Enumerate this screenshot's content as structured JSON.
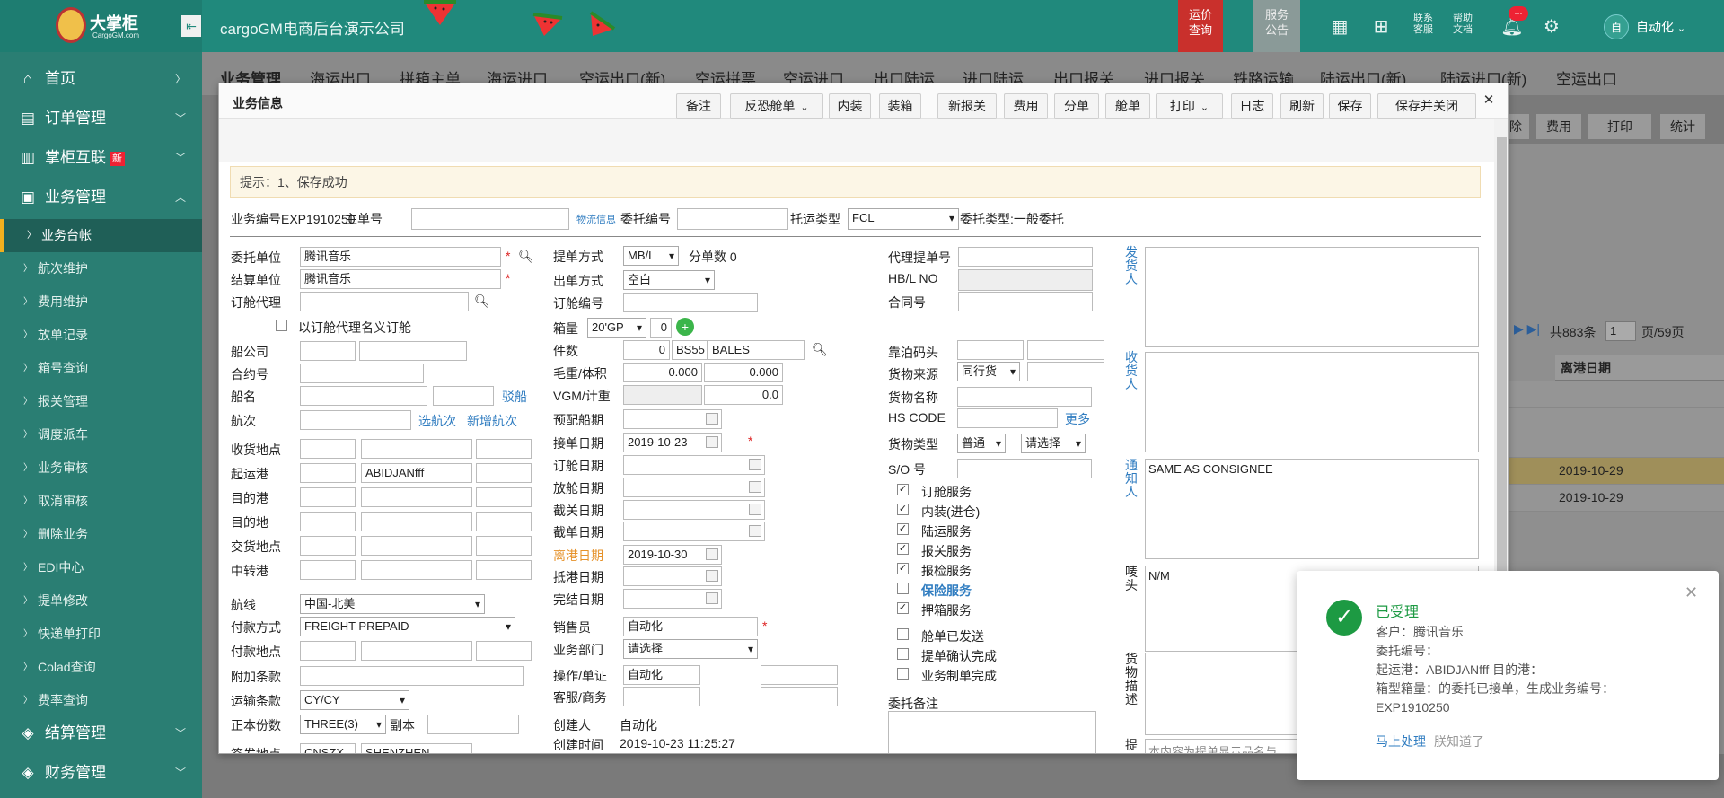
{
  "app": {
    "brand": "大掌柜",
    "brand_sub": "CargoGM.com",
    "title": "cargoGM电商后台演示公司",
    "price_query": "运价\n查询",
    "price_query_l1": "运价",
    "price_query_l2": "查询",
    "service_l1": "服务",
    "service_l2": "公告",
    "contact_l1": "联系",
    "contact_l2": "客服",
    "help_l1": "帮助",
    "help_l2": "文档",
    "notification_badge": "···",
    "avatar_text": "自",
    "username": "自动化"
  },
  "sidebar": {
    "main": [
      {
        "label": "首页",
        "icon": "home-icon"
      },
      {
        "label": "订单管理",
        "icon": "list-icon"
      },
      {
        "label": "掌柜互联",
        "icon": "doc-icon",
        "tag": "新"
      },
      {
        "label": "业务管理",
        "icon": "briefcase-icon"
      },
      {
        "label": "结算管理",
        "icon": "layers-icon"
      },
      {
        "label": "财务管理",
        "icon": "layers-icon"
      }
    ],
    "sub": [
      "业务台帐",
      "航次维护",
      "费用维护",
      "放单记录",
      "箱号查询",
      "报关管理",
      "调度派车",
      "业务审核",
      "取消审核",
      "删除业务",
      "EDI中心",
      "提单修改",
      "快递单打印",
      "Colad查询",
      "费率查询"
    ]
  },
  "tabs": [
    "业务管理",
    "海运出口",
    "拼箱主单",
    "海运进口",
    "空运出口(新)",
    "空运拼票",
    "空运进口",
    "出口陆运",
    "进口陆运",
    "出口报关",
    "进口报关",
    "铁路运输",
    "陆运出口(新)",
    "陆运进口(新)",
    "空运出口"
  ],
  "background": {
    "buttons": [
      "除",
      "费用",
      "打印",
      "统计"
    ],
    "pager_total": "共883条",
    "pager_page": "1",
    "pager_pages": "页/59页",
    "col_header": "离港日期",
    "dates": [
      "2019-10-29",
      "2019-10-29"
    ]
  },
  "modal": {
    "title": "业务信息",
    "toolbar": [
      "备注",
      "反恐舱单",
      "内装",
      "装箱",
      "新报关",
      "费用",
      "分单",
      "舱单",
      "打印",
      "日志",
      "刷新",
      "保存",
      "保存并关闭"
    ],
    "hint": "提示：1、保存成功",
    "header_row": {
      "biz_no_label": "业务编号EXP1910250",
      "main_no_label": "主单号",
      "logistics_link": "物流信息",
      "entrust_no_label": "委托编号",
      "transport_type_label": "托运类型",
      "transport_type_value": "FCL",
      "entrust_type": "委托类型:一般委托"
    },
    "col1": {
      "client_label": "委托单位",
      "client_value": "腾讯音乐",
      "settle_label": "结算单位",
      "settle_value": "腾讯音乐",
      "booking_agent_label": "订舱代理",
      "book_as_agent": "以订舱代理名义订舱",
      "carrier_label": "船公司",
      "contract_label": "合约号",
      "vessel_label": "船名",
      "vessel_link": "驳船",
      "voyage_label": "航次",
      "choose_voyage": "选航次",
      "add_voyage": "新增航次",
      "receipt_label": "收货地点",
      "pol_label": "起运港",
      "pol_value": "ABIDJANfff",
      "pod_label": "目的港",
      "dest_label": "目的地",
      "delivery_label": "交货地点",
      "transit_label": "中转港",
      "route_label": "航线",
      "route_value": "中国-北美",
      "payment_label": "付款方式",
      "payment_value": "FREIGHT PREPAID",
      "pay_place_label": "付款地点",
      "extra_label": "附加条款",
      "terms_label": "运输条款",
      "terms_value": "CY/CY",
      "originals_label": "正本份数",
      "originals_value": "THREE(3)",
      "copies_label": "副本",
      "issue_label": "签发地点",
      "issue_code": "CNSZX",
      "issue_city": "SHENZHEN"
    },
    "col2": {
      "bl_type_label": "提单方式",
      "bl_type_value": "MB/L",
      "split_count": "分单数 0",
      "issue_method_label": "出单方式",
      "issue_method_value": "空白",
      "booking_no_label": "订舱编号",
      "container_label": "箱量",
      "container_type": "20'GP",
      "container_qty": "0",
      "pieces_label": "件数",
      "pieces_value": "0",
      "pieces_code": "BS55",
      "pieces_unit": "BALES",
      "weight_label": "毛重/体积",
      "weight_value": "0.000",
      "volume_value": "0.000",
      "vgm_label": "VGM/计重",
      "vgm_value": "0.0",
      "etd_plan_label": "预配船期",
      "order_date_label": "接单日期",
      "order_date_value": "2019-10-23",
      "booking_date_label": "订舱日期",
      "release_date_label": "放舱日期",
      "customs_cut_label": "截关日期",
      "doc_cut_label": "截单日期",
      "departure_label": "离港日期",
      "departure_value": "2019-10-30",
      "arrival_label": "抵港日期",
      "finish_label": "完结日期",
      "sales_label": "销售员",
      "sales_value": "自动化",
      "dept_label": "业务部门",
      "dept_value": "请选择",
      "operator_label": "操作/单证",
      "operator_value": "自动化",
      "cs_label": "客服/商务",
      "creator_label": "创建人",
      "creator_value": "自动化",
      "created_label": "创建时间",
      "created_value": "2019-10-23 11:25:27"
    },
    "col3": {
      "agent_bl_label": "代理提单号",
      "hbl_label": "HB/L NO",
      "contract_no_label": "合同号",
      "wharf_label": "靠泊码头",
      "goods_source_label": "货物来源",
      "goods_source_value": "同行货",
      "goods_name_label": "货物名称",
      "hs_label": "HS CODE",
      "hs_more": "更多",
      "goods_type_label": "货物类型",
      "goods_type_value": "普通",
      "goods_type_select": "请选择",
      "so_label": "S/O 号",
      "services": [
        {
          "label": "订舱服务",
          "checked": true,
          "link": false
        },
        {
          "label": "内装(进仓)",
          "checked": true,
          "link": false
        },
        {
          "label": "陆运服务",
          "checked": true,
          "link": false
        },
        {
          "label": "报关服务",
          "checked": true,
          "link": false
        },
        {
          "label": "报检服务",
          "checked": true,
          "link": false
        },
        {
          "label": "保险服务",
          "checked": false,
          "link": true
        },
        {
          "label": "押箱服务",
          "checked": true,
          "link": false
        }
      ],
      "status": [
        {
          "label": "舱单已发送",
          "checked": false
        },
        {
          "label": "提单确认完成",
          "checked": false
        },
        {
          "label": "业务制单完成",
          "checked": false
        }
      ],
      "remark_label": "委托备注"
    },
    "col4": {
      "shipper_label": "发货人",
      "consignee_label": "收货人",
      "notify_label": "通知人",
      "notify_value": "SAME AS CONSIGNEE",
      "marks_label": "唛头",
      "marks_value": "N/M",
      "goods_desc_label": "货物描述",
      "bl_label": "提",
      "bl_placeholder": "本内容为提单显示品名与"
    }
  },
  "toast": {
    "title": "已受理",
    "lines": [
      "客户：腾讯音乐",
      "委托编号：",
      "起运港：ABIDJANfff 目的港：",
      "箱型箱量：的委托已接单，生成业务编号：",
      "EXP1910250"
    ],
    "action_primary": "马上处理",
    "action_secondary": "朕知道了"
  },
  "colors": {
    "primary": "#20897c",
    "sidebar": "#2a7e73",
    "accent_red": "#c9302c",
    "success": "#1d9a43",
    "link": "#2f7cc0"
  }
}
